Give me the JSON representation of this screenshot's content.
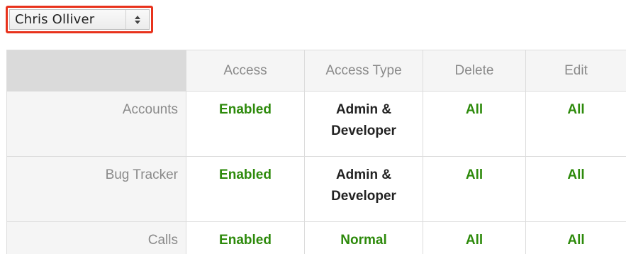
{
  "user_select": {
    "value": "Chris Olliver"
  },
  "table": {
    "headers": [
      "Access",
      "Access Type",
      "Delete",
      "Edit"
    ],
    "rows": [
      {
        "module": "Accounts",
        "access": "Enabled",
        "access_type_line1": "Admin &",
        "access_type_line2": "Developer",
        "delete": "All",
        "edit": "All"
      },
      {
        "module": "Bug Tracker",
        "access": "Enabled",
        "access_type_line1": "Admin &",
        "access_type_line2": "Developer",
        "delete": "All",
        "edit": "All"
      },
      {
        "module": "Calls",
        "access": "Enabled",
        "access_type_line1": "Normal",
        "delete": "All",
        "edit": "All"
      }
    ]
  },
  "colors": {
    "highlight": "#e8321c",
    "enabled_green": "#2d8a0b",
    "header_gray": "#8a8a8a"
  }
}
